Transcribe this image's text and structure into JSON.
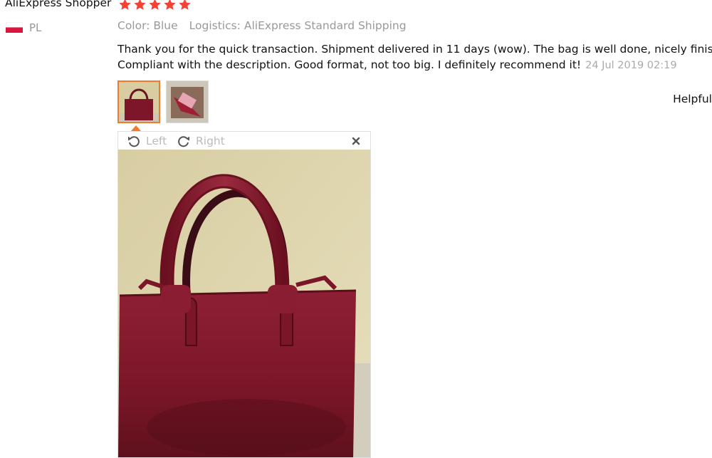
{
  "review": {
    "reviewer_name": "AliExpress Shopper",
    "rating": 5,
    "country_code": "PL",
    "color_label": "Color: Blue",
    "logistics_label": "Logistics: AliExpress Standard Shipping",
    "text_line1": "Thank you for the quick transaction. Shipment delivered in 11 days (wow). The bag is well done, nicely finished.",
    "text_line2": "Compliant with the description. Good format, not too big. I definitely recommend it!",
    "date": "24 Jul 2019 02:19",
    "helpful_label": "Helpful"
  },
  "viewer": {
    "rotate_left_label": "Left",
    "rotate_right_label": "Right",
    "close_icon": "close-icon"
  },
  "colors": {
    "star": "#f44336",
    "accent_border": "#f07c2b",
    "muted_text": "#999999",
    "bag": "#7d1628"
  }
}
